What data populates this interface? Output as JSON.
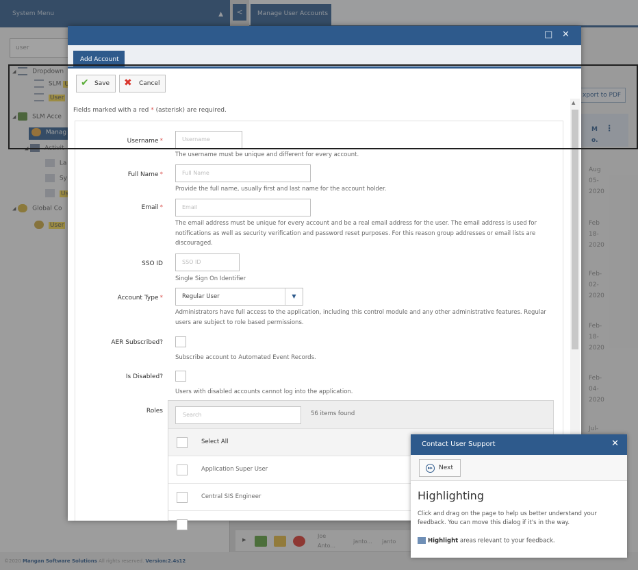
{
  "background": {
    "system_menu_label": "System Menu",
    "back_glyph": "<",
    "menu_collapse_glyph": "▲",
    "active_tab": "Manage User Accounts",
    "search_value": "user",
    "tree": [
      {
        "label": "Dropdown",
        "highlight": ""
      },
      {
        "label": "SLM ",
        "highlight": "U"
      },
      {
        "label": "",
        "highlight": "User"
      },
      {
        "label": "SLM Acce",
        "highlight": ""
      },
      {
        "label": "Manag",
        "highlight": ""
      },
      {
        "label": "Activit",
        "highlight": ""
      },
      {
        "label": "La",
        "highlight": ""
      },
      {
        "label": "Sy",
        "highlight": ""
      },
      {
        "label": "",
        "highlight": "Us"
      },
      {
        "label": "Global Co",
        "highlight": ""
      },
      {
        "label": "",
        "highlight": "User"
      }
    ],
    "export_label": "xport to PDF",
    "column_header": "M",
    "column_header_sub": "o.",
    "dates": [
      [
        "Aug",
        "05-",
        "2020"
      ],
      [
        "Feb",
        "18-",
        "2020"
      ],
      [
        "Feb-",
        "02-",
        "2020"
      ],
      [
        "Feb-",
        "18-",
        "2020"
      ],
      [
        "Feb-",
        "04-",
        "2020"
      ],
      [
        "Jul-"
      ]
    ],
    "row_name": "Joe",
    "row_name_2": "Anto...",
    "row_col1": "janto...",
    "row_col2": "janto",
    "footer": {
      "copyright": "©2020 ",
      "company": "Mangan Software Solutions",
      "rights": " All rights reserved. ",
      "version": "Version:2.4s12"
    }
  },
  "modal": {
    "tab_label": "Add Account",
    "maximize_glyph": "□",
    "close_glyph": "✕",
    "save_label": "Save",
    "cancel_label": "Cancel",
    "required_note_pre": "Fields marked with a red ",
    "required_note_star": "*",
    "required_note_post": " (asterisk) are required.",
    "fields": {
      "username": {
        "label": "Username",
        "placeholder": "Username",
        "help": "The username must be unique and different for every account."
      },
      "full_name": {
        "label": "Full Name",
        "placeholder": "Full Name",
        "help": "Provide the full name, usually first and last name for the account holder."
      },
      "email": {
        "label": "Email",
        "placeholder": "Email",
        "help": "The email address must be unique for every account and be a real email address for the user. The email address is used for notifications as well as security verification and password reset purposes. For this reason group addresses or email lists are discouraged."
      },
      "sso_id": {
        "label": "SSO ID",
        "placeholder": "SSO ID",
        "help": "Single Sign On Identifier"
      },
      "account_type": {
        "label": "Account Type",
        "value": "Regular User",
        "help": "Administrators have full access to the application, including this control module and any other administrative features. Regular users are subject to role based permissions."
      },
      "aer_subscribed": {
        "label": "AER Subscribed?",
        "help": "Subscribe account to Automated Event Records."
      },
      "is_disabled": {
        "label": "Is Disabled?",
        "help": "Users with disabled accounts cannot log into the application."
      },
      "roles": {
        "label": "Roles",
        "search_placeholder": "Search",
        "count_text": "56 items found",
        "select_all": "Select All",
        "items": [
          "Application Super User",
          "Central SIS Engineer"
        ]
      }
    }
  },
  "support": {
    "title": "Contact User Support",
    "close_glyph": "✕",
    "next_label": "Next",
    "heading": "Highlighting",
    "body": "Click and drag on the page to help us better understand your feedback. You can move this dialog if it's in the way.",
    "hint_bold": "Highlight",
    "hint_rest": " areas relevant to your feedback."
  },
  "colors": {
    "primary": "#2e5a8c",
    "required_star": "#d9534f",
    "save_check": "#5cae3a",
    "cancel_x": "#d9342b",
    "highlight": "#f3d54a"
  }
}
